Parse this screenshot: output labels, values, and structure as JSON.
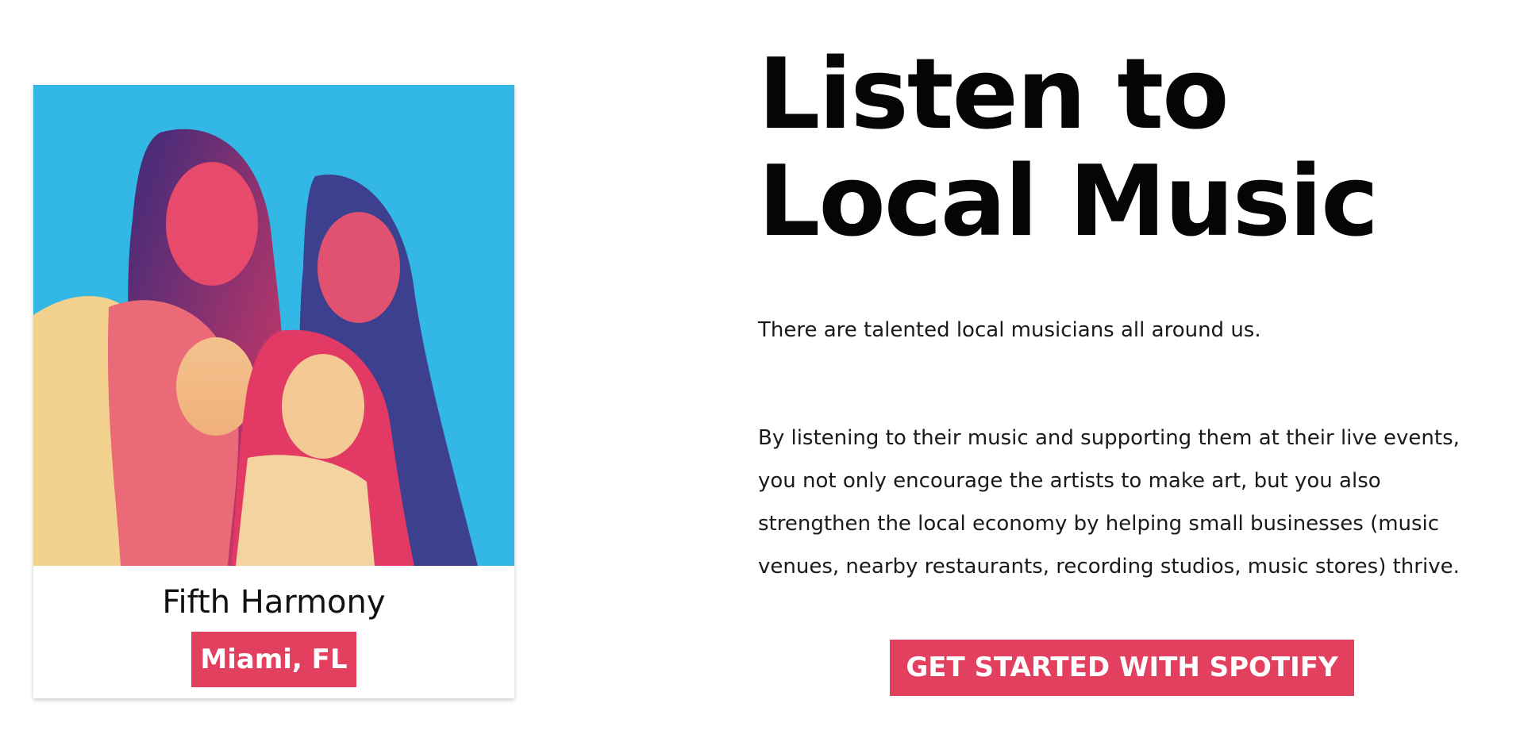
{
  "featured_artist": {
    "image_alt": "Fifth Harmony band photo",
    "name": "Fifth Harmony",
    "location": "Miami, FL"
  },
  "hero": {
    "headline": "Listen to Local Music",
    "intro": "There are talented local musicians all around us.",
    "body": "By listening to their music and supporting them at their live events, you not only encourage the artists to make art, but you also strengthen the local economy by helping small businesses (music venues, nearby restaurants, recording studios, music stores) thrive.",
    "cta_label": "GET STARTED WITH SPOTIFY"
  },
  "colors": {
    "accent": "#e34060",
    "image_background": "#33b8e6",
    "text": "#111111"
  }
}
